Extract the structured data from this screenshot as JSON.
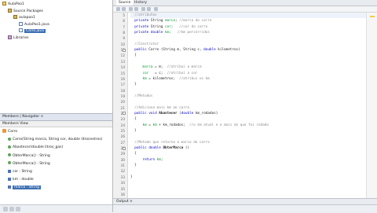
{
  "projects_tree": [
    {
      "label": "AulaPoo1",
      "icon": "project-icon",
      "depth": 0
    },
    {
      "label": "Source Packages",
      "icon": "package-folder-icon",
      "depth": 1
    },
    {
      "label": "aulapoo1",
      "icon": "package-icon",
      "depth": 2
    },
    {
      "label": "AulaPoo1.java",
      "icon": "java-file-icon",
      "depth": 3
    },
    {
      "label": "Carro.java",
      "icon": "java-file-icon",
      "depth": 3,
      "selected": true
    },
    {
      "label": "Libraries",
      "icon": "library-icon",
      "depth": 1
    }
  ],
  "navigator": {
    "tab_label": "Members | Navigator ×",
    "filter_label": "Members View"
  },
  "members_tree": [
    {
      "label": "Carro",
      "icon": "class-icon",
      "depth": 0
    },
    {
      "label": "Carro(String marca, String cor, double litrosnetros)",
      "icon": "constructor-icon",
      "depth": 1
    },
    {
      "label": "Abastecer(double litros_gas)",
      "icon": "method-icon",
      "depth": 1
    },
    {
      "label": "ObterMarca() : String",
      "icon": "method-icon",
      "depth": 1
    },
    {
      "label": "ObterMarca() : String",
      "icon": "method-icon",
      "depth": 1
    },
    {
      "label": "cor : String",
      "icon": "field-icon",
      "depth": 1
    },
    {
      "label": "km : double",
      "icon": "field-icon",
      "depth": 1
    },
    {
      "label": "marca : String",
      "icon": "field-icon",
      "depth": 1,
      "selected": true
    }
  ],
  "editor": {
    "tab_source": "Source",
    "tab_history": "History",
    "output_label": "Output ×"
  },
  "code_lines": [
    {
      "n": "5",
      "html": "  <span class='cm'>//atributos</span>",
      "hl": true
    },
    {
      "n": "6",
      "html": "  <span class='kw'>private</span> String <span class='fld'>marca</span>; <span class='cm'>//marca do carro</span>"
    },
    {
      "n": "7",
      "html": "  <span class='kw'>private</span> String <span class='fld'>cor</span>;   <span class='cm'>//cor do carro</span>"
    },
    {
      "n": "8",
      "html": "  <span class='kw'>private</span> <span class='kw'>double</span> <span class='fld'>km</span>;   <span class='cm'>//km percorridos</span>"
    },
    {
      "n": "9",
      "html": ""
    },
    {
      "n": "10",
      "html": "  <span class='cm'>//Construtor</span>"
    },
    {
      "n": "11",
      "html": "  <span class='kw'>public</span> Carro (String m, String c, <span class='kw'>double</span> kilometros)",
      "fold": true
    },
    {
      "n": "12",
      "html": "  {"
    },
    {
      "n": "13",
      "html": ""
    },
    {
      "n": "14",
      "html": "      <span class='fld'>marca</span> = m;  <span class='cm'>//atribui a marca</span>"
    },
    {
      "n": "15",
      "html": "      <span class='fld'>cor</span>   = c;  <span class='cm'>//atribui a cor</span>"
    },
    {
      "n": "16",
      "html": "      <span class='fld'>km</span> = kilometros;  <span class='cm'>//atribui os km</span>"
    },
    {
      "n": "17",
      "html": "  }"
    },
    {
      "n": "18",
      "html": ""
    },
    {
      "n": "19",
      "html": "  <span class='cm'>//Metodos</span>"
    },
    {
      "n": "20",
      "html": ""
    },
    {
      "n": "21",
      "html": "  <span class='cm'>//Adiciona mais km ao carro</span>"
    },
    {
      "n": "22",
      "html": "  <span class='kw'>public</span> <span class='kw'>void</span> <b>Abastecer</b> (<span class='kw'>double</span> km_rodados)",
      "fold": true
    },
    {
      "n": "23",
      "html": "  {"
    },
    {
      "n": "24",
      "html": "      <span class='fld'>km</span> = <span class='fld'>km</span> + km_rodados;  <span class='cm'>//o km atual e a mais do que foi rodado</span>"
    },
    {
      "n": "25",
      "html": "  }"
    },
    {
      "n": "26",
      "html": ""
    },
    {
      "n": "27",
      "html": "  <span class='cm'>//Metodo que retorna a marca do carro</span>"
    },
    {
      "n": "28",
      "html": "  <span class='kw'>public</span> <span class='kw'>double</span> <b>ObterMarca</b> ()",
      "fold": true
    },
    {
      "n": "29",
      "html": "  {"
    },
    {
      "n": "30",
      "html": "      <span class='kw'>return</span> <span class='fld'>km</span>;"
    },
    {
      "n": "31",
      "html": "  }"
    },
    {
      "n": "32",
      "html": ""
    },
    {
      "n": "33",
      "html": "}"
    },
    {
      "n": "34",
      "html": ""
    },
    {
      "n": "35",
      "html": ""
    },
    {
      "n": "36",
      "html": ""
    }
  ]
}
